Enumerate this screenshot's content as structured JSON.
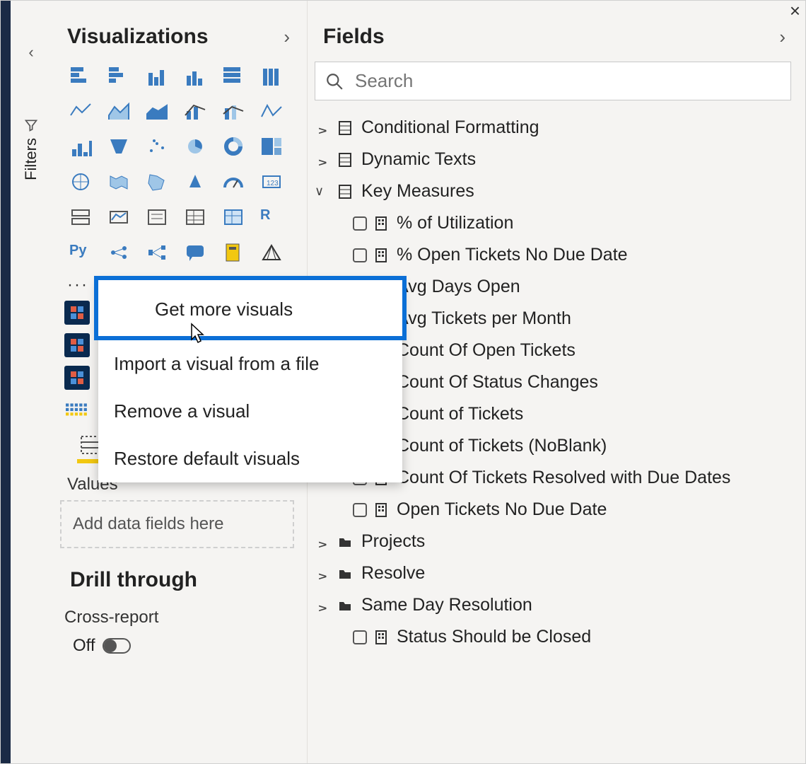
{
  "close_label": "×",
  "filters_tab": {
    "label": "Filters"
  },
  "visualizations": {
    "title": "Visualizations",
    "icons": [
      "stacked-bar",
      "clustered-bar",
      "stacked-column",
      "clustered-column",
      "100-stacked-bar",
      "100-stacked-column",
      "line",
      "area",
      "stacked-area",
      "line-clustered-column",
      "line-stacked-column",
      "ribbon",
      "waterfall",
      "funnel",
      "scatter",
      "pie",
      "donut",
      "treemap",
      "map",
      "filled-map",
      "shape-map",
      "azure-map",
      "gauge",
      "card",
      "multi-row-card",
      "kpi",
      "slicer",
      "table",
      "matrix",
      "r-visual",
      "py-visual",
      "key-influencers",
      "decomposition-tree",
      "qa",
      "paginated",
      "arcgis"
    ],
    "icon_labels": {
      "r-visual": "R",
      "py-visual": "Py"
    },
    "ellipsis": "···",
    "popup": [
      "Get more visuals",
      "Import a visual from a file",
      "Remove a visual",
      "Restore default visuals"
    ],
    "extra_count": 3,
    "tabs": {
      "fields": "fields-tab",
      "format": "format-tab"
    },
    "values_label": "Values",
    "values_placeholder": "Add data fields here",
    "drill_title": "Drill through",
    "cross_label": "Cross-report",
    "toggle_off": "Off"
  },
  "fields": {
    "title": "Fields",
    "search_placeholder": "Search",
    "groups": [
      {
        "name": "Conditional Formatting",
        "expanded": false,
        "type": "table"
      },
      {
        "name": "Dynamic Texts",
        "expanded": false,
        "type": "table"
      },
      {
        "name": "Key Measures",
        "expanded": true,
        "type": "table",
        "measures": [
          "% of Utilization",
          "% Open Tickets No Due Date",
          "Avg Days Open",
          "Avg Tickets per Month",
          "Count Of Open Tickets",
          "Count Of Status Changes",
          "Count of Tickets",
          "Count of Tickets (NoBlank)",
          "Count Of Tickets Resolved with Due Dates",
          "Open Tickets No Due Date"
        ]
      },
      {
        "name": "Projects",
        "expanded": false,
        "type": "folder"
      },
      {
        "name": "Resolve",
        "expanded": false,
        "type": "folder"
      },
      {
        "name": "Same Day Resolution",
        "expanded": false,
        "type": "folder",
        "measures": [
          "Status Should be Closed"
        ],
        "force_show_children": true
      }
    ]
  }
}
